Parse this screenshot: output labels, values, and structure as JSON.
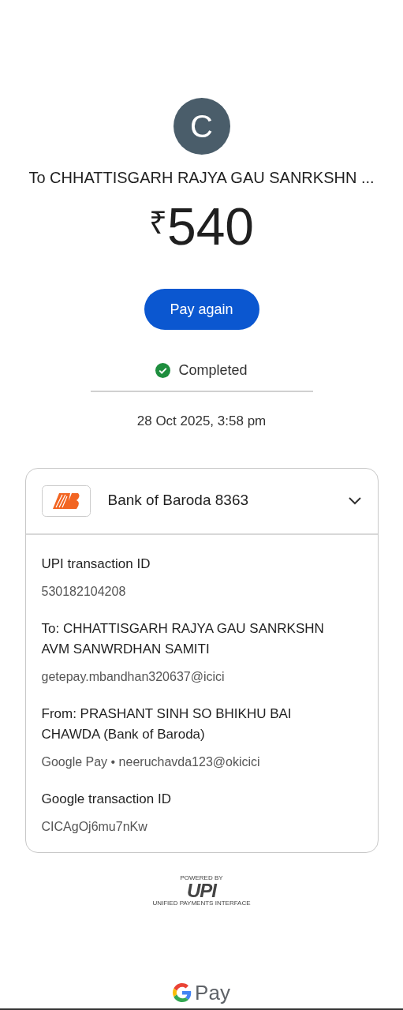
{
  "avatar": {
    "initial": "C"
  },
  "recipient": "To CHHATTISGARH RAJYA GAU SANRKSHN ...",
  "amount": {
    "currency": "₹",
    "value": "540"
  },
  "pay_again_button": "Pay again",
  "status": {
    "label": "Completed",
    "completed": true
  },
  "date": "28 Oct 2025, 3:58 pm",
  "card": {
    "bank": "Bank of Baroda 8363",
    "expanded": true,
    "details": [
      {
        "label": "UPI transaction ID",
        "value": "530182104208"
      },
      {
        "label": "To: CHHATTISGARH RAJYA GAU SANRKSHN AVM SANWRDHAN SAMITI",
        "value": "getepay.mbandhan320637@icici"
      },
      {
        "label": "From: PRASHANT SINH SO BHIKHU BAI CHAWDA (Bank of Baroda)",
        "value": "Google Pay • neeruchavda123@okicici"
      },
      {
        "label": "Google transaction ID",
        "value": "CICAgOj6mu7nKw"
      }
    ]
  },
  "upi_logo": {
    "powered_by": "POWERED BY",
    "mark": "UPI",
    "tagline": "UNIFIED PAYMENTS INTERFACE"
  },
  "footer_logo": {
    "text": "Pay"
  }
}
